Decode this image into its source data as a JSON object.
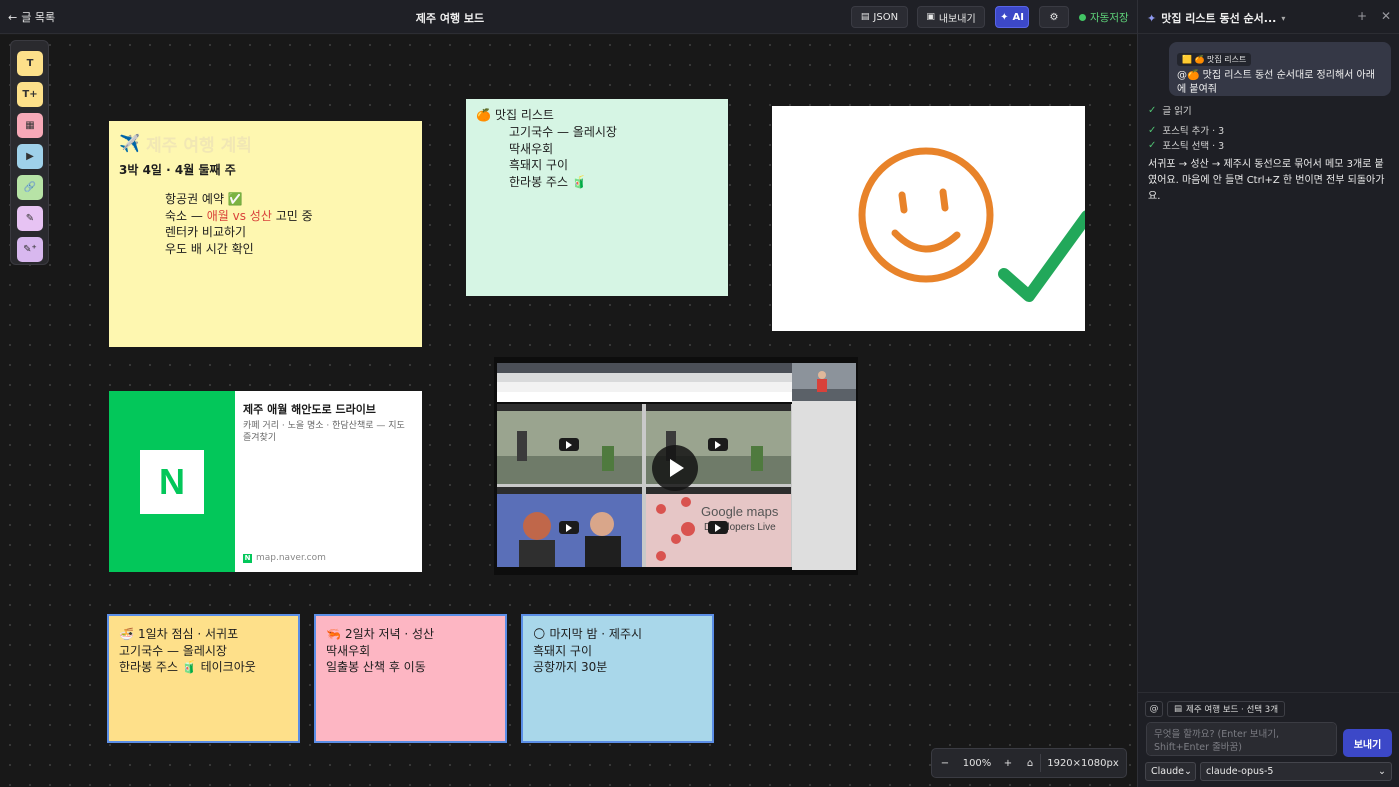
{
  "topbar": {
    "back_label": "글 목록",
    "board_title": "제주 여행 보드",
    "json_label": "JSON",
    "export_label": "내보내기",
    "ai_label": "AI",
    "autosave_label": "자동저장"
  },
  "tools": [
    {
      "label": "T",
      "color": "#fde08a"
    },
    {
      "label": "T+",
      "color": "#fde08a"
    },
    {
      "label": "▦",
      "color": "#f7a9b8"
    },
    {
      "label": "▶",
      "color": "#9fd1ea"
    },
    {
      "label": "🔗",
      "color": "#b7e3a6"
    },
    {
      "label": "✎",
      "color": "#e7c3f3"
    },
    {
      "label": "✎⁺",
      "color": "#d8b8ef"
    }
  ],
  "plan_note": {
    "icon": "✈️",
    "title": "제주 여행 계획",
    "subtitle": "3박 4일 · 4월 둘째 주",
    "item1": "항공권 예약 ✅",
    "item2_pre": "숙소 — ",
    "item2_hl": "애월 vs 성산",
    "item2_post": " 고민 중",
    "item3": "렌터카 비교하기",
    "item4": "우도 배 시간 확인"
  },
  "food_note": {
    "icon": "🍊",
    "title": "맛집 리스트",
    "items": [
      "고기국수 — 올레시장",
      "딱새우회",
      "흑돼지 구이",
      "한라봉 주스 🧃"
    ]
  },
  "link_card": {
    "logo": "N",
    "title": "제주 애월 해안도로 드라이브",
    "desc": "카페 거리 · 노을 명소 · 한담산책로 — 지도 즐겨찾기",
    "url": "map.naver.com"
  },
  "video": {
    "maps_text1": "Google maps",
    "maps_text2": "Developers Live"
  },
  "days": [
    {
      "icon": "🍜",
      "title": "1일차 점심 · 서귀포",
      "l2": "고기국수 — 올레시장",
      "l3": "한라봉 주스 🧃 테이크아웃"
    },
    {
      "icon": "🦐",
      "title": "2일차 저녁 · 성산",
      "l2": "딱새우회",
      "l3": "일출봉 산책 후 이동"
    },
    {
      "icon": "🌕",
      "title": "마지막 밤 · 제주시",
      "l2": "흑돼지 구이",
      "l3": "공항까지 30분"
    }
  ],
  "zoom": {
    "minus": "−",
    "level": "100%",
    "plus": "+",
    "home": "⌂",
    "canvas_size": "1920×1080px"
  },
  "panel": {
    "title": "맛집 리스트 동선 순서...",
    "chip": "🟨 🍊 맛집 리스트",
    "user_message": "@🍊 맛집 리스트 동선 순서대로 정리해서 아래에 붙여줘",
    "steps": [
      "글 읽기",
      "포스틱 추가 · 3",
      "포스틱 선택 · 3"
    ],
    "reply": "서귀포 → 성산 → 제주시 동선으로 묶어서 메모 3개로 붙였어요. 마음에 안 들면 Ctrl+Z 한 번이면 전부 되돌아가요.",
    "context_chip": "제주 여행 보드 · 선택 3개",
    "prompt_placeholder": "무엇을 할까요? (Enter 보내기, Shift+Enter 줄바꿈)",
    "send_label": "보내기",
    "provider": "Claude",
    "model": "claude-opus-5"
  },
  "colors": {
    "accent": "#3c48c8",
    "autosave": "#42c464",
    "naver": "#03c75a"
  }
}
